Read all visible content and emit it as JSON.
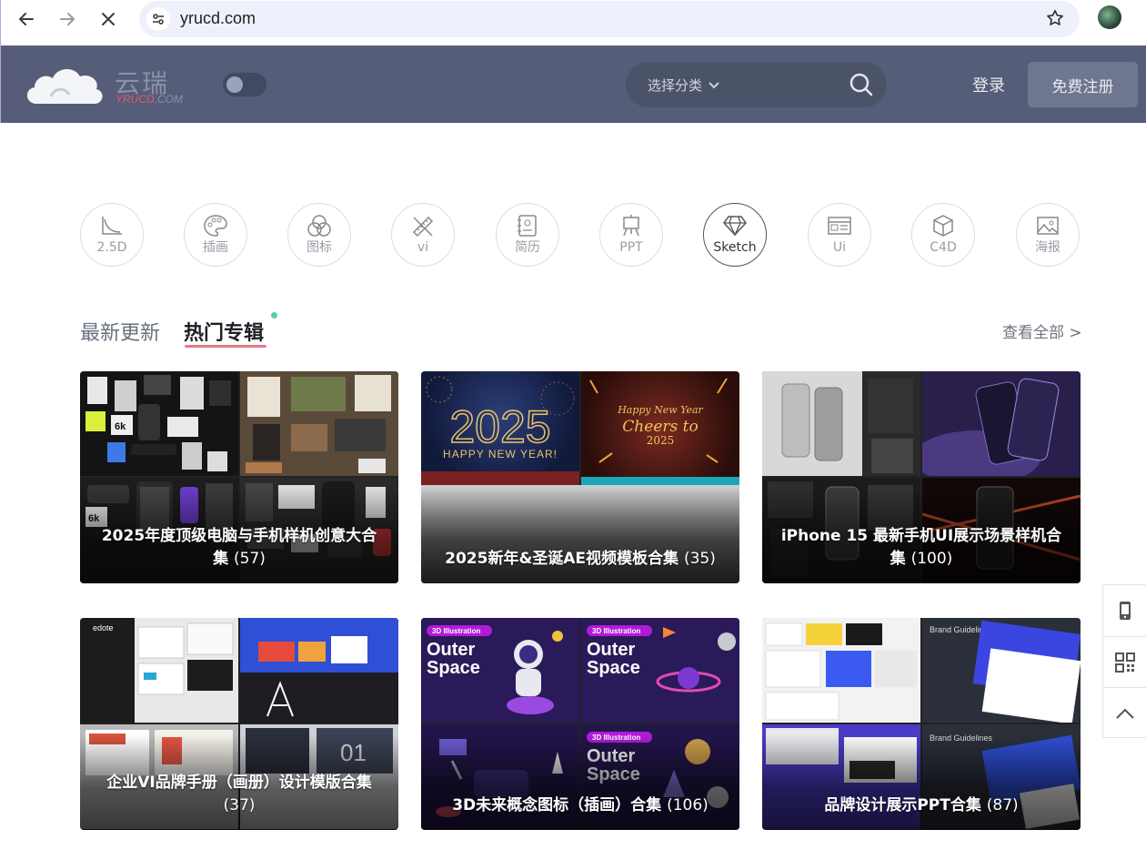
{
  "browser": {
    "url": "yrucd.com",
    "icons": [
      "back-arrow-icon",
      "forward-arrow-icon",
      "stop-loading-icon",
      "site-info-icon",
      "bookmark-star-icon",
      "profile-avatar"
    ]
  },
  "header": {
    "logo_cn": "云瑞",
    "logo_en_accent": "YRUCD",
    "logo_en_rest": ".COM",
    "search_category": "选择分类",
    "login": "登录",
    "register": "免费注册",
    "colors": {
      "header_bg": "#555d78",
      "accent": "#e57a88"
    }
  },
  "categories": [
    {
      "label": "2.5D",
      "icon": "curve-icon",
      "active": false
    },
    {
      "label": "插画",
      "icon": "palette-icon",
      "active": false
    },
    {
      "label": "图标",
      "icon": "circles-icon",
      "active": false
    },
    {
      "label": "vi",
      "icon": "ruler-pencil-icon",
      "active": false
    },
    {
      "label": "简历",
      "icon": "resume-icon",
      "active": false
    },
    {
      "label": "PPT",
      "icon": "easel-icon",
      "active": false
    },
    {
      "label": "Sketch",
      "icon": "diamond-icon",
      "active": true
    },
    {
      "label": "Ui",
      "icon": "ui-window-icon",
      "active": false
    },
    {
      "label": "C4D",
      "icon": "cube-icon",
      "active": false
    },
    {
      "label": "海报",
      "icon": "image-icon",
      "active": false
    }
  ],
  "tabs": {
    "latest": "最新更新",
    "hot": "热门专辑",
    "view_all": "查看全部 >"
  },
  "cards": [
    {
      "title": "2025年度顶级电脑与手机样机创意大合集",
      "count": "(57)"
    },
    {
      "title": "2025新年&圣诞AE视频模板合集",
      "count": "(35)"
    },
    {
      "title": "iPhone 15 最新手机UI展示场景样机合集",
      "count": "(100)"
    },
    {
      "title": "企业VI品牌手册（画册）设计模版合集",
      "count": "(37)"
    },
    {
      "title": "3D未来概念图标（插画）合集",
      "count": "(106)"
    },
    {
      "title": "品牌设计展示PPT合集",
      "count": "(87)"
    }
  ],
  "card_thumbs": {
    "c2_year": "2025",
    "c2_happy": "HAPPY NEW YEAR!",
    "c2_script1": "Happy New Year",
    "c2_script2": "Cheers to",
    "c2_script3": "2025",
    "c5_badge": "3D Illustration",
    "c5_outer": "Outer",
    "c5_space": "Space",
    "c4_logo": "edote",
    "c6_brand": "Brand Guidelines"
  },
  "side_tools": [
    "mobile-icon",
    "qr-code-icon",
    "back-to-top-icon"
  ]
}
